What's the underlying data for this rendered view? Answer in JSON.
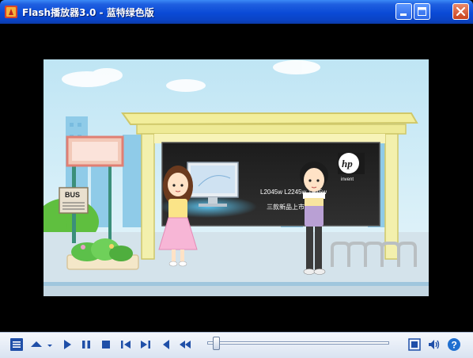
{
  "window": {
    "title": "Flash播放器3.0 - 蓝特绿色版"
  },
  "video_content": {
    "bus_sign": "BUS",
    "billboard_models": "L2045w  L2245w  1945w",
    "billboard_slogan": "三款新品上市",
    "brand_logo": "hp",
    "brand_tagline": "invent"
  },
  "controls": {
    "seek_position": 0.03,
    "icons": [
      "playlist-icon",
      "eject-icon",
      "menu-arrow-icon",
      "play-icon",
      "pause-icon",
      "stop-icon",
      "previous-icon",
      "next-icon",
      "step-back-icon",
      "rewind-icon",
      "fullscreen-icon",
      "volume-icon",
      "help-icon"
    ]
  },
  "colors": {
    "title_bar": "#0a4ad6",
    "control_bar": "#dde6f3",
    "icon_blue": "#1f4fa8"
  }
}
